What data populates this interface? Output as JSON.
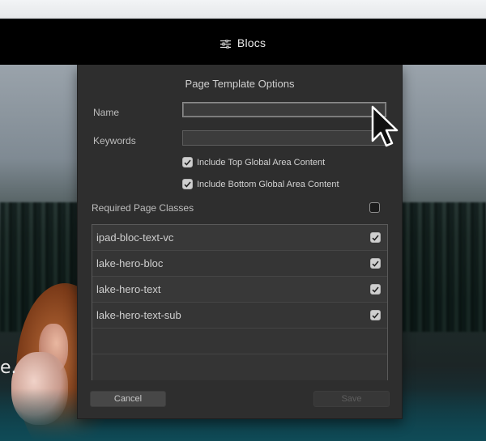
{
  "window": {
    "title": "Blocs",
    "title_icon": "sliders-icon"
  },
  "background": {
    "edge_text": "e."
  },
  "dialog": {
    "heading": "Page Template Options",
    "name_label": "Name",
    "name_value": "",
    "keywords_label": "Keywords",
    "keywords_value": "",
    "include_top_label": "Include Top Global Area Content",
    "include_top_checked": true,
    "include_bottom_label": "Include Bottom Global Area Content",
    "include_bottom_checked": true,
    "required_classes_label": "Required Page Classes",
    "required_classes_checked": false,
    "classes": [
      {
        "name": "ipad-bloc-text-vc",
        "checked": true
      },
      {
        "name": "lake-hero-bloc",
        "checked": true
      },
      {
        "name": "lake-hero-text",
        "checked": true
      },
      {
        "name": "lake-hero-text-sub",
        "checked": true
      }
    ],
    "cancel_label": "Cancel",
    "save_label": "Save"
  }
}
